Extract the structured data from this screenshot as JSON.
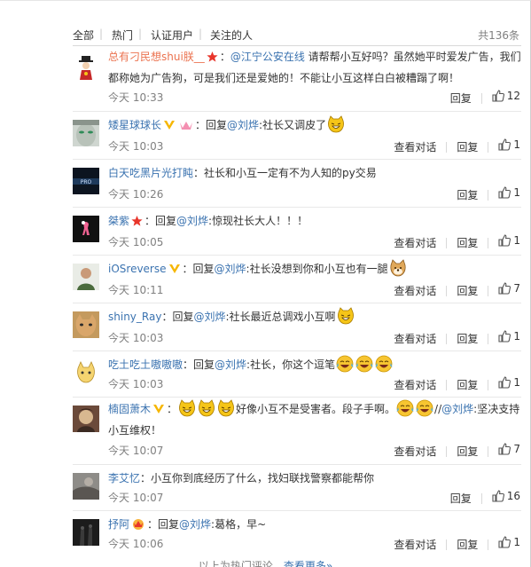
{
  "filter": {
    "tabs": [
      "全部",
      "热门",
      "认证用户",
      "关注的人"
    ],
    "total": "共136条"
  },
  "actions": {
    "reply": "回复",
    "view_dialog": "查看对话"
  },
  "comments": [
    {
      "user": "总有刁民想shui朕__",
      "text_parts": [
        "：",
        "@江宁公安在线",
        " 请帮帮小互好吗？虽然她平时爱发广告，我们都称她为广告狗，可是我们还是爱她的！不能让小互这样白白被糟蹋了啊！"
      ],
      "time": "今天 10:33",
      "likes": "12"
    },
    {
      "user": "矮星球球长",
      "reply_prefix": "：回复",
      "mention": "@刘烨",
      "text": ":社长又调皮了",
      "time": "今天 10:03",
      "likes": "1"
    },
    {
      "user": "白天吃黑片光打盹",
      "text": "：社长和小互一定有不为人知的py交易",
      "time": "今天 10:26",
      "likes": "1"
    },
    {
      "user": "桀紫",
      "reply_prefix": "：回复",
      "mention": "@刘烨",
      "text": ":惊现社长大人！！！",
      "time": "今天 10:05",
      "likes": "1"
    },
    {
      "user": "iOSreverse",
      "reply_prefix": "：回复",
      "mention": "@刘烨",
      "text": ":社长没想到你和小互也有一腿",
      "time": "今天 10:11",
      "likes": "7"
    },
    {
      "user": "shiny_Ray",
      "reply_prefix": "：回复",
      "mention": "@刘烨",
      "text": ":社长最近总调戏小互啊",
      "time": "今天 10:03",
      "likes": "1"
    },
    {
      "user": "吃土吃土嗷嗷嗷",
      "reply_prefix": "：回复",
      "mention": "@刘烨",
      "text": ":社长，你这个逗笔",
      "time": "今天 10:03",
      "likes": "1"
    },
    {
      "user": "楠固萧木",
      "text_a": "好像小互不是受害者。段子手啊。",
      "slash": "//",
      "mention": "@刘烨",
      "text_b": ":坚决支持小互维权！",
      "time": "今天 10:07",
      "likes": "7"
    },
    {
      "user": "李艾忆",
      "text": "：小互你到底经历了什么，找妇联找警察都能帮你",
      "time": "今天 10:07",
      "likes": "16"
    },
    {
      "user": "抒阿",
      "reply_prefix": "：回复",
      "mention": "@刘烨",
      "text": ":葛格，早~",
      "time": "今天 10:06",
      "likes": "1"
    }
  ],
  "footer": {
    "text": "以上为热门评论，",
    "more": "查看更多»"
  },
  "colors": {
    "username": "#eb7350",
    "link": "#3b73b0",
    "muted": "#808080",
    "badge_red": "#e8352b",
    "vip_gold": "#f6b600"
  }
}
